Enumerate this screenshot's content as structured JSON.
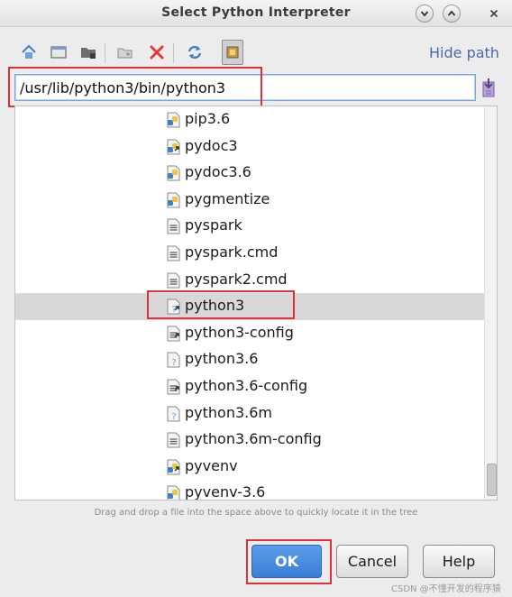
{
  "window": {
    "title": "Select Python Interpreter"
  },
  "toolbar": {
    "buttons": [
      "home-icon",
      "desktop-icon",
      "project-folder-icon",
      "new-folder-icon",
      "delete-icon",
      "refresh-icon",
      "show-hidden-icon"
    ],
    "hide_path_label": "Hide path"
  },
  "path": {
    "value": "/usr/lib/python3/bin/python3"
  },
  "tree": {
    "items": [
      {
        "name": "pip3.6",
        "icon": "python-file-icon"
      },
      {
        "name": "pydoc3",
        "icon": "python-link-icon"
      },
      {
        "name": "pydoc3.6",
        "icon": "python-file-icon"
      },
      {
        "name": "pygmentize",
        "icon": "python-file-icon"
      },
      {
        "name": "pyspark",
        "icon": "text-file-icon"
      },
      {
        "name": "pyspark.cmd",
        "icon": "text-file-icon"
      },
      {
        "name": "pyspark2.cmd",
        "icon": "text-file-icon"
      },
      {
        "name": "python3",
        "icon": "unknown-link-icon"
      },
      {
        "name": "python3-config",
        "icon": "text-link-icon"
      },
      {
        "name": "python3.6",
        "icon": "unknown-file-icon"
      },
      {
        "name": "python3.6-config",
        "icon": "text-link-icon"
      },
      {
        "name": "python3.6m",
        "icon": "unknown-file-icon"
      },
      {
        "name": "python3.6m-config",
        "icon": "text-file-icon"
      },
      {
        "name": "pyvenv",
        "icon": "python-link-icon"
      },
      {
        "name": "pyvenv-3.6",
        "icon": "python-file-icon"
      }
    ],
    "selected": "python3"
  },
  "hint": "Drag and drop a file into the space above to quickly locate it in the tree",
  "buttons": {
    "ok": "OK",
    "cancel": "Cancel",
    "help": "Help"
  },
  "watermark": "CSDN @不懂开发的程序猿",
  "colors": {
    "highlight_box": "#e0313a",
    "primary_button": "#3a7fd8",
    "link": "#4a69a8"
  }
}
